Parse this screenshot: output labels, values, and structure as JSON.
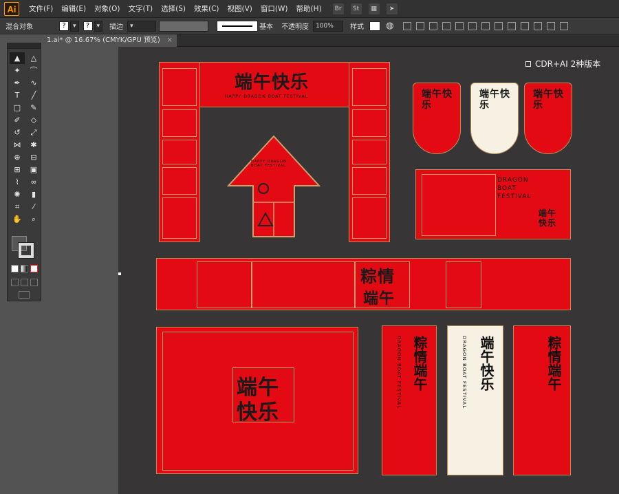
{
  "app": {
    "logo": "Ai"
  },
  "menu": {
    "items": [
      "文件(F)",
      "编辑(E)",
      "对象(O)",
      "文字(T)",
      "选择(S)",
      "效果(C)",
      "视图(V)",
      "窗口(W)",
      "帮助(H)"
    ],
    "icons": [
      "bridge-icon",
      "stock-icon",
      "workspace-icon",
      "sync-icon"
    ],
    "icon_glyphs": [
      "Br",
      "St",
      "▦",
      "➤"
    ]
  },
  "control_bar": {
    "object_type": "混合对象",
    "stroke_label": "描边",
    "stroke_style": "基本",
    "opacity_label": "不透明度",
    "opacity_value": "100%",
    "style_label": "样式"
  },
  "document_tab": {
    "title": "1.ai* @ 16.67% (CMYK/GPU 预览)",
    "close": "×"
  },
  "note": "CDR+AI 2种版本",
  "artwork": {
    "arch_title": "端午快乐",
    "arch_en": "HAPPY DRAGON BOAT FESTIVAL",
    "arrow_en": "HAPPY DRAGON BOAT FESTIVAL",
    "badge_left": "端午快乐",
    "badge_middle": "端午快乐",
    "badge_right": "端午快乐",
    "card_en_1": "DRAGON",
    "card_en_2": "BOAT",
    "card_en_3": "FESTIVAL",
    "card_cn": "端午快乐",
    "banner_cn_1": "粽情",
    "banner_cn_2": "端午",
    "poster_cn_1": "端午",
    "poster_cn_2": "快乐",
    "vert_left_cn": "粽情端午",
    "vert_left_en": "DRAGON BOAT FESTIVAL",
    "vert_middle_cn": "端午快乐",
    "vert_middle_en": "DRAGON BOAT FESTIVAL",
    "vert_right_cn": "粽情端午"
  },
  "colors": {
    "accent_red": "#e30a14",
    "gold_line": "#c8a26b",
    "dark_canvas": "#383536"
  }
}
